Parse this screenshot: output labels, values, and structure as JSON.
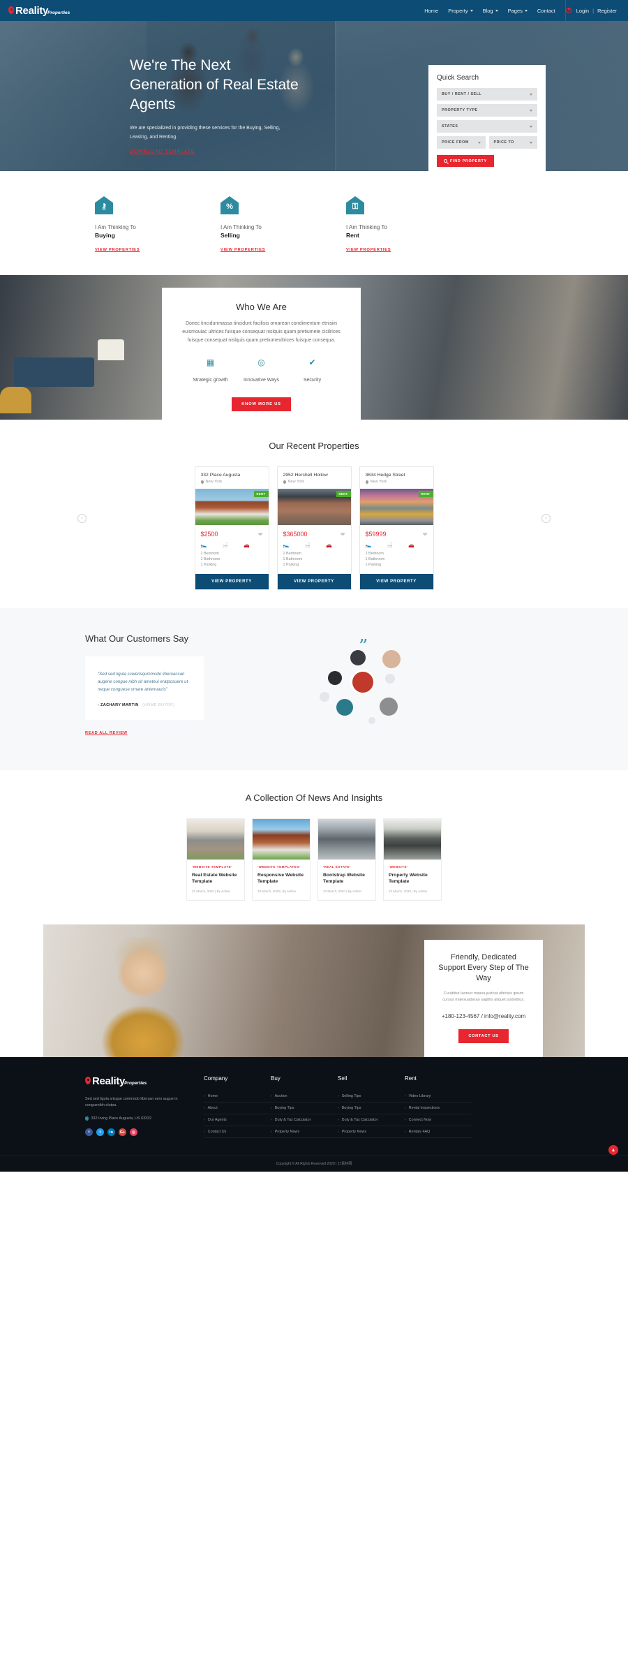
{
  "brand": {
    "name": "Reality",
    "sub": "Properties"
  },
  "header": {
    "nav": [
      {
        "label": "Home",
        "caret": false
      },
      {
        "label": "Property",
        "caret": true
      },
      {
        "label": "Blog",
        "caret": true
      },
      {
        "label": "Pages",
        "caret": true
      },
      {
        "label": "Contact",
        "caret": false
      }
    ],
    "login": "Login",
    "divider": "|",
    "register": "Register"
  },
  "hero": {
    "heading": "We're The Next Generation of Real Estate Agents",
    "paragraph": "We are specialized in providing these services for the Buying, Selling, Leasing, and Renting.",
    "link": "DOWNLOAD TEMPLATE"
  },
  "quick_search": {
    "title": "Quick Search",
    "fields": [
      {
        "label": "BUY / RENT / SELL"
      },
      {
        "label": "PROPERTY TYPE"
      },
      {
        "label": "STATES"
      }
    ],
    "price_from": "PRICE FROM",
    "price_to": "PRICE TO",
    "button": "FIND PROPERTY"
  },
  "thinking": [
    {
      "icon": "house-key-icon",
      "glyph": "⚷",
      "pre": "I Am Thinking To",
      "action": "Buying",
      "link": "VIEW PROPERTIES"
    },
    {
      "icon": "house-percent-icon",
      "glyph": "%",
      "pre": "I Am Thinking To",
      "action": "Selling",
      "link": "VIEW PROPERTIES"
    },
    {
      "icon": "house-lock-icon",
      "glyph": "⚿",
      "pre": "I Am Thinking To",
      "action": "Rent",
      "link": "VIEW PROPERTIES"
    }
  ],
  "who_we_are": {
    "title": "Who We Are",
    "paragraph": "Donec tincidunmassa tincidunt facilisis ornarean condimentum etnisiin euismouiac ultrices fuisque consequat nislquis quam pretiumete cicilrices fuisque consequat nislquis quam pretiumeultrices fuisque consequa.",
    "features": [
      {
        "icon": "bar-chart-icon",
        "glyph": "▦",
        "label": "Strategic growth"
      },
      {
        "icon": "lightbulb-icon",
        "glyph": "◎",
        "label": "Innovative Ways"
      },
      {
        "icon": "shield-icon",
        "glyph": "✔",
        "label": "Security"
      }
    ],
    "button": "KNOW MORE US"
  },
  "properties": {
    "title": "Our Recent Properties",
    "cards": [
      {
        "title": "332 Place Augusta",
        "location": "New York",
        "tag": "RENT",
        "price": "$2500",
        "bedroom": "2 Bedroom",
        "bathroom": "1 Bathroom",
        "parking": "1 Parking",
        "button": "VIEW PROPERTY"
      },
      {
        "title": "2952 Hershell Hollow",
        "location": "New York",
        "tag": "RENT",
        "price": "$365000",
        "bedroom": "2 Bedroom",
        "bathroom": "1 Bathroom",
        "parking": "1 Parking",
        "button": "VIEW PROPERTY"
      },
      {
        "title": "3634 Hedge Street",
        "location": "New York",
        "tag": "RENT",
        "price": "$59999",
        "bedroom": "2 Bedroom",
        "bathroom": "1 Bathroom",
        "parking": "1 Parking",
        "button": "VIEW PROPERTY"
      }
    ],
    "prev": "‹",
    "next": "›"
  },
  "testimonials": {
    "title": "What Our Customers Say",
    "quote": "“Sed sed ligula scelerisqummodo liberoacsan augene congue nibh sit ameteui eratposuere ut neque conguese ornare antemauris”",
    "author": "- ZACHARY MARTIN",
    "role": "(HOME BUYER)",
    "link": "READ ALL REVIEW",
    "quote_mark": "”"
  },
  "news": {
    "title": "A Collection Of News And Insights",
    "cards": [
      {
        "category": "'WEBSITE TEMPLATE'",
        "title": "Real Estate Website Template",
        "meta": "23 March, 2020  |  By Admin"
      },
      {
        "category": "'WEBSITE TEMPLATES'",
        "title": "Responsive Website Template",
        "meta": "23 March, 2020  |  By Admin"
      },
      {
        "category": "'REAL ESTATE'",
        "title": "Bootstrap Website Template",
        "meta": "23 March, 2020  |  By Admin"
      },
      {
        "category": "'WEBSITE'",
        "title": "Property Website Template",
        "meta": "23 March, 2020  |  By Admin"
      }
    ]
  },
  "support": {
    "title": "Friendly, Dedicated Support Every Step of The Way",
    "paragraph": "Curabitur laoreet massa justoat ultricies ipsum cursus malesuadarao sagittis aliquet justoribus.",
    "contact": "+180-123-4567 / info@reality.com",
    "button": "CONTACT US"
  },
  "footer": {
    "desc": "Sed sed ligula srisque commodo libersan sero augue in conguenibh olutpa.",
    "address": "332 Irving Place Augusta, US 63332",
    "socials": [
      {
        "name": "facebook-icon",
        "glyph": "f",
        "color": "#3b5998"
      },
      {
        "name": "twitter-icon",
        "glyph": "t",
        "color": "#1da1f2"
      },
      {
        "name": "linkedin-icon",
        "glyph": "in",
        "color": "#0077b5"
      },
      {
        "name": "google-plus-icon",
        "glyph": "G+",
        "color": "#db4437"
      },
      {
        "name": "instagram-icon",
        "glyph": "◎",
        "color": "#e4405f"
      }
    ],
    "columns": [
      {
        "heading": "Company",
        "links": [
          "Home",
          "About",
          "Our Agents",
          "Contact Us"
        ]
      },
      {
        "heading": "Buy",
        "links": [
          "Auction",
          "Buying Tips",
          "Duty & Tax Calculator",
          "Property News"
        ]
      },
      {
        "heading": "Sell",
        "links": [
          "Selling Tips",
          "Buying Tips",
          "Duty & Tax Calculator",
          "Property News"
        ]
      },
      {
        "heading": "Rent",
        "links": [
          "Video Library",
          "Rental Inspections",
          "Connect Now",
          "Rentals FAQ"
        ]
      }
    ],
    "copyright": "Copyright © All Rights Reserved 2020 | 17素材网",
    "top_arrow": "▲"
  },
  "colors": {
    "navy": "#0d4c75",
    "red": "#e8262f",
    "teal": "#2d8ba0",
    "green": "#4caf2a",
    "footer_bg": "#0c1117"
  }
}
